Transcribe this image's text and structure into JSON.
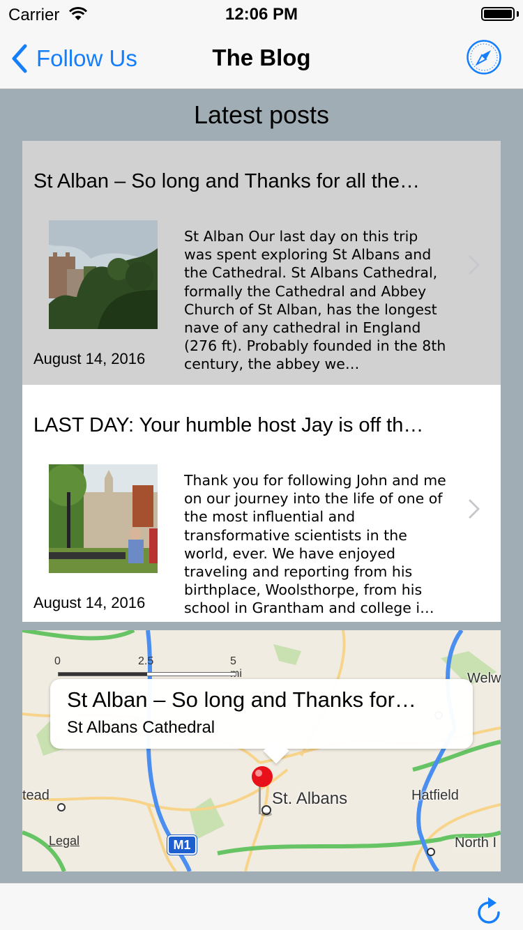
{
  "status_bar": {
    "carrier": "Carrier",
    "time": "12:06 PM",
    "battery_level": 1.0
  },
  "nav_bar": {
    "back_label": "Follow Us",
    "title": "The Blog",
    "right_icon": "safari-compass-icon",
    "accent_color": "#147efb"
  },
  "section_title": "Latest posts",
  "posts": [
    {
      "title": "St Alban – So long and Thanks for all the…",
      "date": "August 14, 2016",
      "excerpt": "St Alban Our last day on this trip was spent exploring St Albans and the Cathedral. St Albans Cathedral, formally the Cathedral and Abbey Church of St Alban, has the longest nave of any cathedral in England (276 ft). Probably founded in the 8th century, the abbey we…",
      "selected": true
    },
    {
      "title": "LAST DAY: Your humble host Jay is off th…",
      "date": "August 14, 2016",
      "excerpt": "Thank you for following John and me on our journey into the life of one of the most influential and transformative scientists in the world, ever. We have enjoyed traveling and reporting from his birthplace, Woolsthorpe, from his school in Grantham and college i…",
      "selected": false
    }
  ],
  "map": {
    "scale_labels": [
      "0",
      "2.5",
      "5 mi"
    ],
    "callout_title": "St Alban – So long and Thanks for…",
    "callout_subtitle": "St Albans Cathedral",
    "places": {
      "st_albans": "St. Albans",
      "hatfield": "Hatfield",
      "welwyn": "Welw",
      "hempstead": "tead",
      "north": "North I"
    },
    "road_shield": "M1",
    "legal": "Legal"
  },
  "toolbar": {
    "refresh_icon": "refresh-icon"
  }
}
